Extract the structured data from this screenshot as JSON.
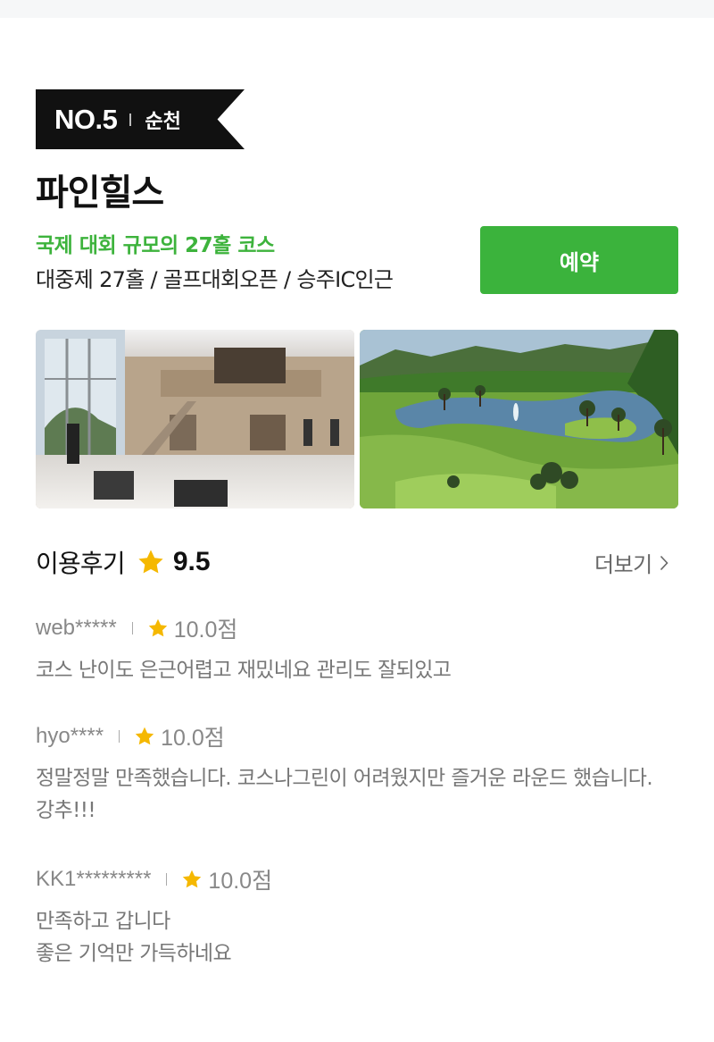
{
  "course": {
    "rank": "NO.5",
    "region": "순천",
    "name": "파인힐스",
    "headline": "국제 대회 규모의 27홀 코스",
    "specs": "대중제 27홀 / 골프대회오픈 / 승주IC인근",
    "reserve_label": "예약",
    "accent_color": "#3bb33c"
  },
  "photos": [
    {
      "name": "lobby-photo",
      "subject": "clubhouse lobby"
    },
    {
      "name": "course-photo",
      "subject": "golf course with lake"
    }
  ],
  "reviews_section": {
    "title": "이용후기",
    "score": "9.5",
    "more_label": "더보기",
    "star_color": "#f5b800"
  },
  "reviews": [
    {
      "user": "web*****",
      "score": "10.0점",
      "text": "코스 난이도 은근어렵고 재밌네요 관리도 잘되있고"
    },
    {
      "user": "hyo****",
      "score": "10.0점",
      "text": "정말정말 만족했습니다. 코스나그린이 어려웠지만 즐거운 라운드 했습니다. 강추!!!"
    },
    {
      "user": "KK1*********",
      "score": "10.0점",
      "text": "만족하고 갑니다\n 좋은 기억만 가득하네요"
    }
  ]
}
